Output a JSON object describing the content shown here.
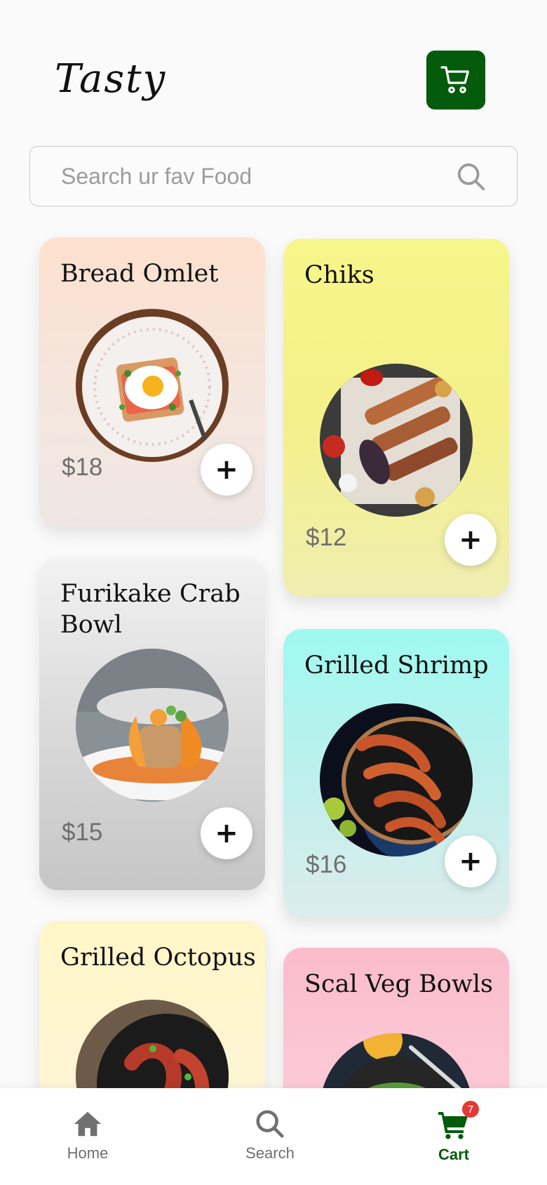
{
  "header": {
    "logo_text": "Tasty",
    "cart_button_icon": "cart-icon",
    "accent_color": "#035b0b"
  },
  "search": {
    "placeholder": "Search ur fav Food",
    "value": "",
    "icon": "search-icon"
  },
  "foods": [
    {
      "name": "Bread Omlet",
      "price": "$18",
      "add_label": "+"
    },
    {
      "name": "Chiks",
      "price": "$12",
      "add_label": "+"
    },
    {
      "name": "Furikake Crab Bowl",
      "price": "$15",
      "add_label": "+"
    },
    {
      "name": "Grilled Shrimp",
      "price": "$16",
      "add_label": "+"
    },
    {
      "name": "Grilled Octopus",
      "price": "",
      "add_label": "+"
    },
    {
      "name": "Scal Veg Bowls",
      "price": "",
      "add_label": "+"
    }
  ],
  "bottom_nav": {
    "items": [
      {
        "label": "Home",
        "icon": "home-icon"
      },
      {
        "label": "Search",
        "icon": "search-icon"
      },
      {
        "label": "Cart",
        "icon": "cart-icon",
        "badge": "7",
        "active": true
      }
    ]
  }
}
